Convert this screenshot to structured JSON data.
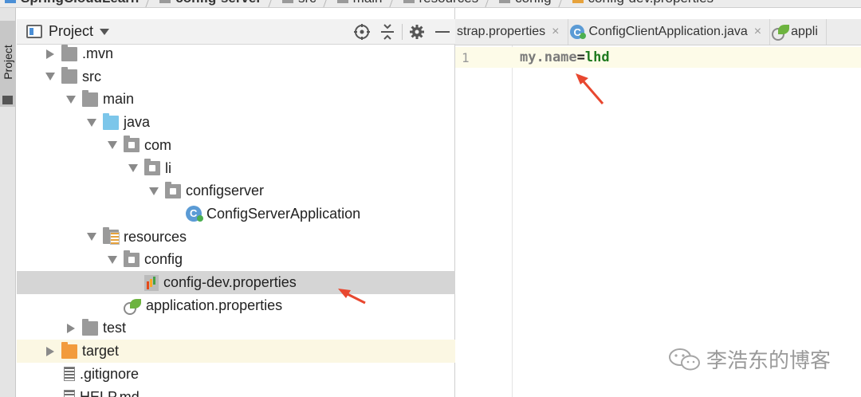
{
  "breadcrumb": [
    {
      "label": "SpringCloudLearn",
      "icon": "module-icon",
      "bold": true
    },
    {
      "label": "config-server",
      "icon": "folder-icon",
      "bold": true
    },
    {
      "label": "src",
      "icon": "folder-icon",
      "bold": false
    },
    {
      "label": "main",
      "icon": "folder-icon",
      "bold": false
    },
    {
      "label": "resources",
      "icon": "resources-folder-icon",
      "bold": false
    },
    {
      "label": "config",
      "icon": "folder-icon",
      "bold": false
    },
    {
      "label": "config-dev.properties",
      "icon": "properties-file-icon",
      "bold": false
    }
  ],
  "toolstrip": {
    "tab_label": "Project"
  },
  "project_panel": {
    "title": "Project",
    "tools": [
      "locate-icon",
      "collapse-icon",
      "gear-icon",
      "hide-icon"
    ]
  },
  "tree": [
    {
      "label": ".mvn",
      "depth": 0,
      "arrow": "right",
      "icon": "folder"
    },
    {
      "label": "src",
      "depth": 0,
      "arrow": "down",
      "icon": "folder"
    },
    {
      "label": "main",
      "depth": 1,
      "arrow": "down",
      "icon": "folder"
    },
    {
      "label": "java",
      "depth": 2,
      "arrow": "down",
      "icon": "folder-blue"
    },
    {
      "label": "com",
      "depth": 3,
      "arrow": "down",
      "icon": "package"
    },
    {
      "label": "li",
      "depth": 4,
      "arrow": "down",
      "icon": "package"
    },
    {
      "label": "configserver",
      "depth": 5,
      "arrow": "down",
      "icon": "package"
    },
    {
      "label": "ConfigServerApplication",
      "depth": 6,
      "arrow": "none",
      "icon": "class"
    },
    {
      "label": "resources",
      "depth": 2,
      "arrow": "down",
      "icon": "resources"
    },
    {
      "label": "config",
      "depth": 3,
      "arrow": "down",
      "icon": "package"
    },
    {
      "label": "config-dev.properties",
      "depth": 4,
      "arrow": "none",
      "icon": "properties",
      "state": "selected"
    },
    {
      "label": "application.properties",
      "depth": 3,
      "arrow": "none",
      "icon": "spring"
    },
    {
      "label": "test",
      "depth": 1,
      "arrow": "right",
      "icon": "folder"
    },
    {
      "label": "target",
      "depth": 0,
      "arrow": "right",
      "icon": "folder-orange",
      "state": "highlight"
    },
    {
      "label": ".gitignore",
      "depth": 0,
      "arrow": "none",
      "icon": "file"
    },
    {
      "label": "HELP.md",
      "depth": 0,
      "arrow": "none",
      "icon": "file"
    }
  ],
  "editor": {
    "tabs": [
      {
        "label": "strap.properties",
        "icon": "none"
      },
      {
        "label": "ConfigClientApplication.java",
        "icon": "class"
      },
      {
        "label": "appli",
        "icon": "spring"
      }
    ],
    "line_number": "1",
    "code": {
      "key": "my.name",
      "eq": "=",
      "value": "lhd"
    }
  },
  "watermark": {
    "text": "李浩东的博客",
    "icon": "wechat-icon"
  },
  "colors": {
    "annotation_arrow": "#e8472f",
    "selected_row": "#d5d5d5",
    "code_value": "#1f7a1f"
  }
}
